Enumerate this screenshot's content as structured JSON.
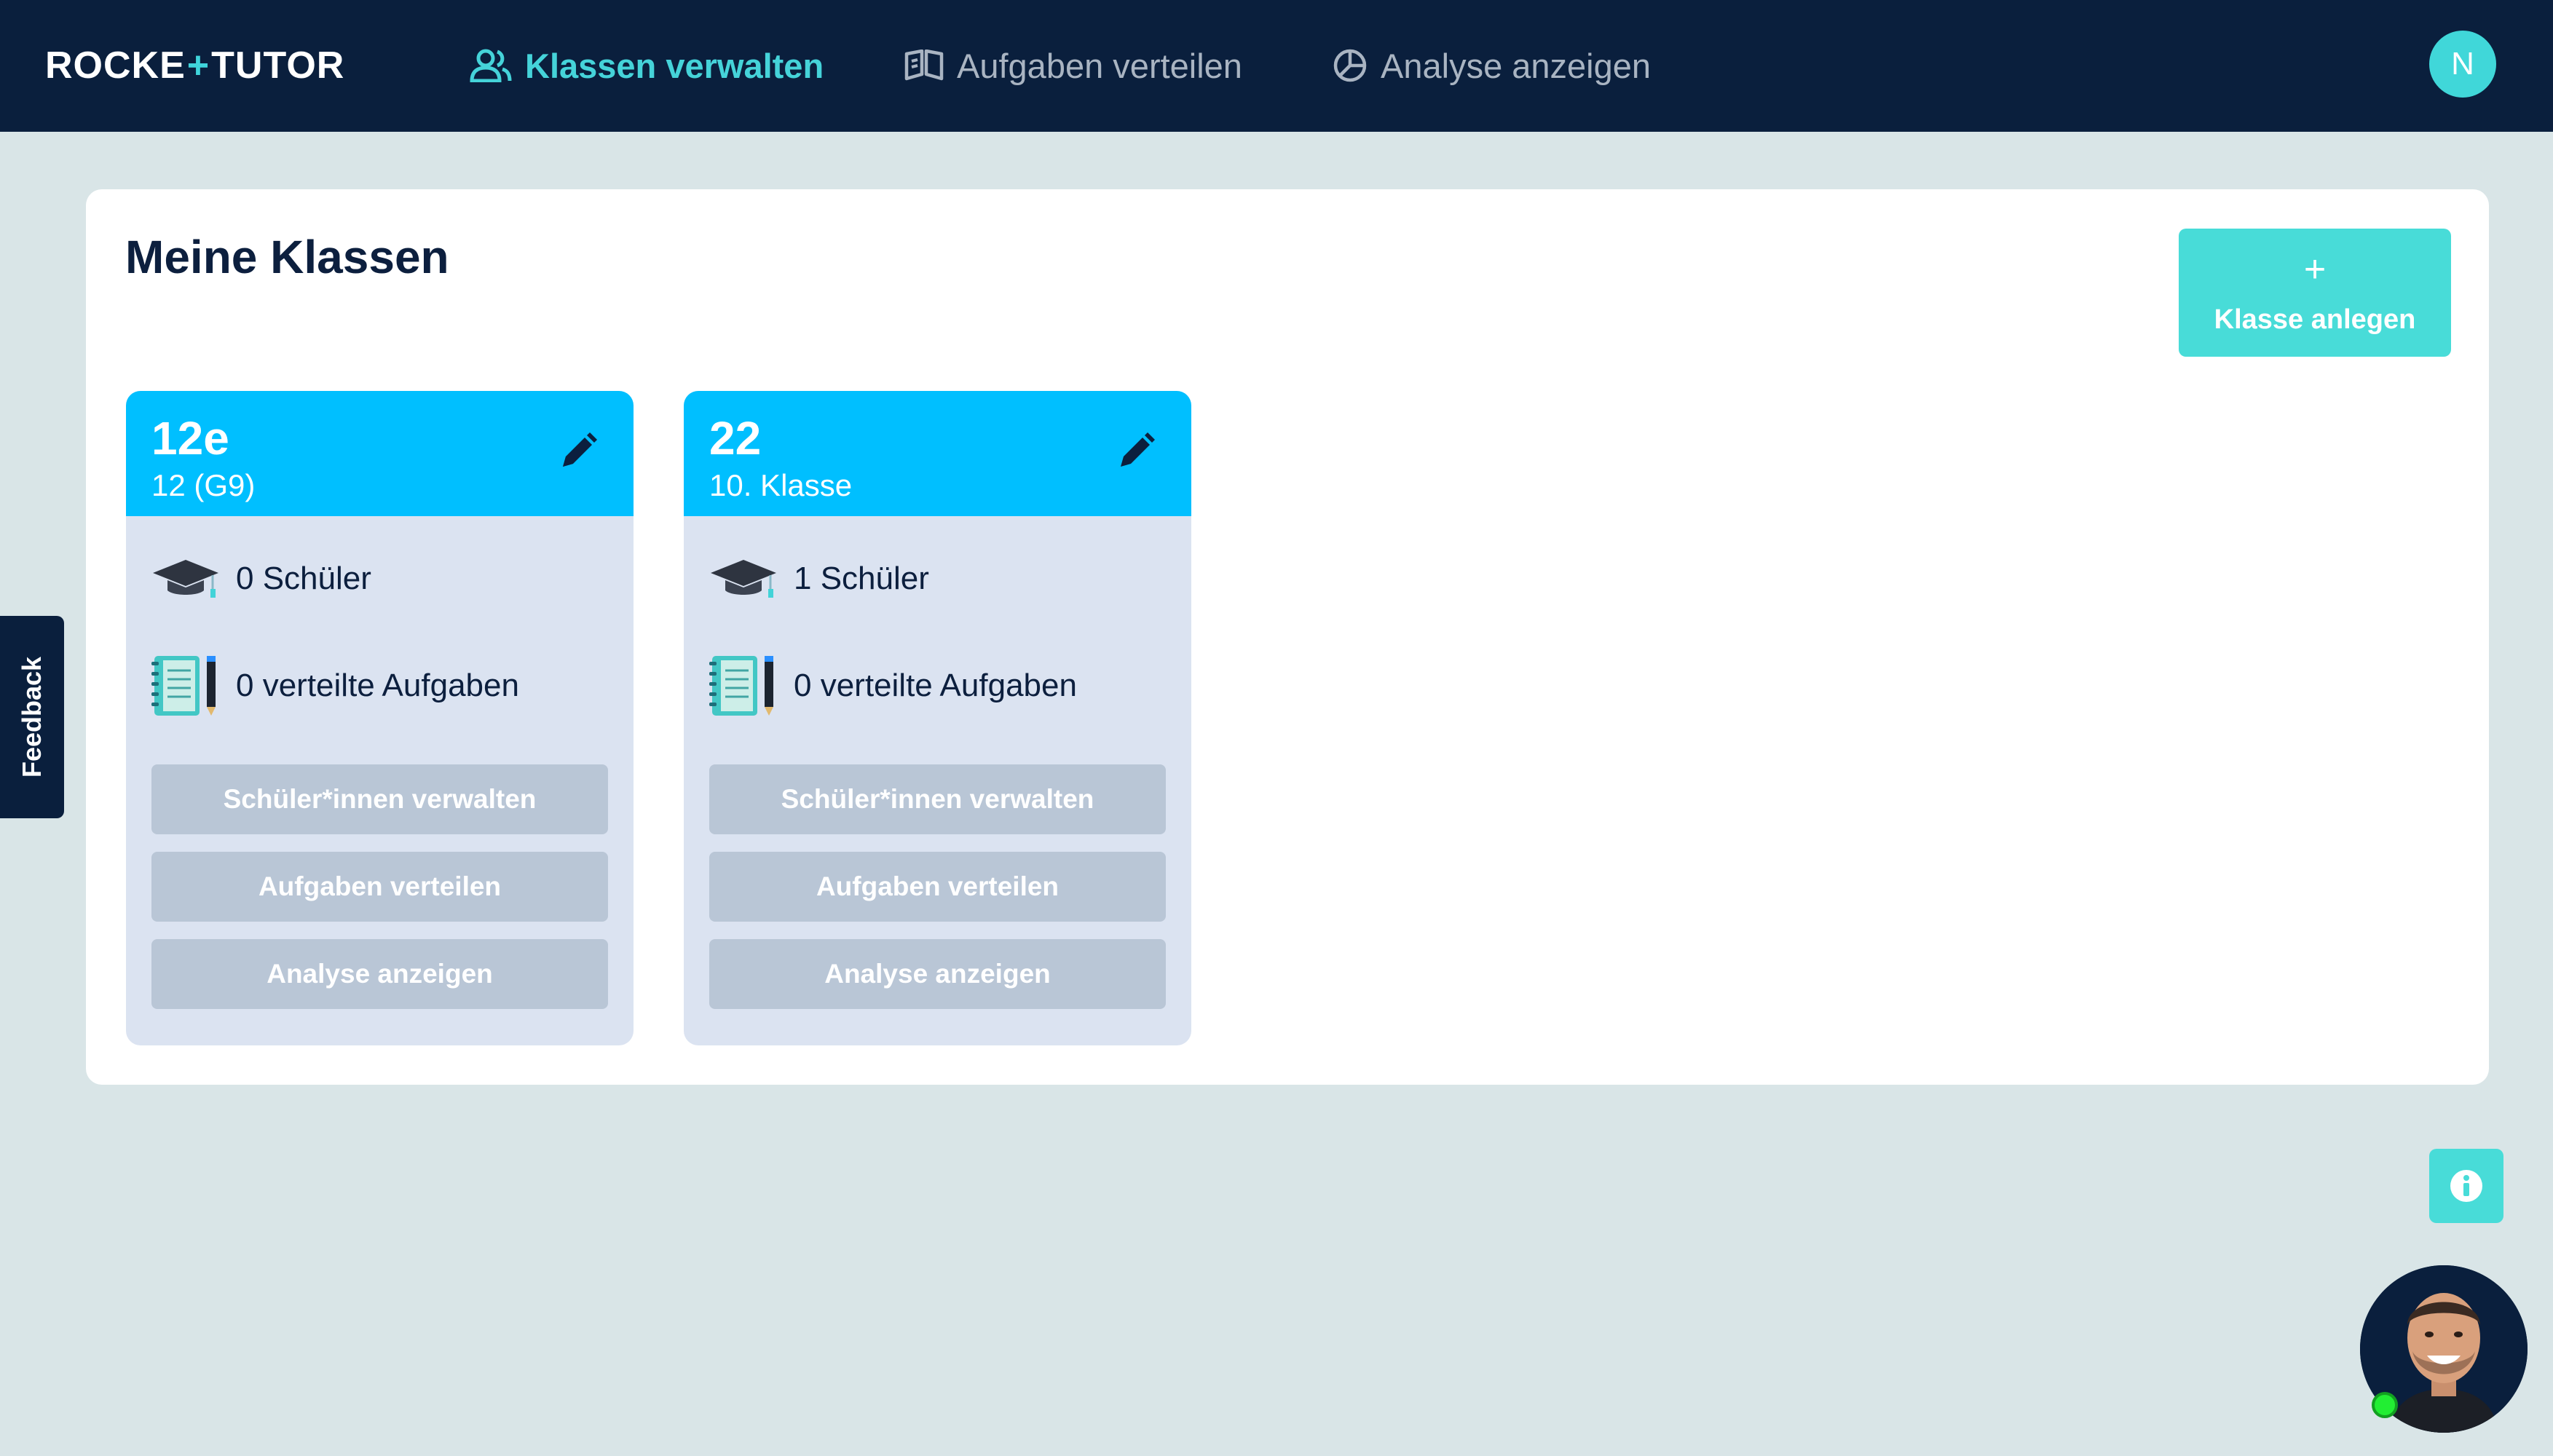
{
  "logo": {
    "part1": "ROCKE",
    "plus": "+",
    "part2": "TUTO",
    "part3": "R"
  },
  "nav": {
    "items": [
      {
        "label": "Klassen verwalten",
        "icon": "users-icon",
        "active": true
      },
      {
        "label": "Aufgaben verteilen",
        "icon": "book-icon",
        "active": false
      },
      {
        "label": "Analyse anzeigen",
        "icon": "pie-chart-icon",
        "active": false
      }
    ]
  },
  "user": {
    "initial": "N"
  },
  "main": {
    "title": "Meine Klassen",
    "add_button": {
      "plus": "+",
      "label": "Klasse anlegen"
    }
  },
  "classes": [
    {
      "name": "12e",
      "subtitle": "12 (G9)",
      "students": "0 Schüler",
      "tasks": "0 verteilte Aufgaben",
      "buttons": [
        "Schüler*innen verwalten",
        "Aufgaben verteilen",
        "Analyse anzeigen"
      ]
    },
    {
      "name": "22",
      "subtitle": "10. Klasse",
      "students": "1 Schüler",
      "tasks": "0 verteilte Aufgaben",
      "buttons": [
        "Schüler*innen verwalten",
        "Aufgaben verteilen",
        "Analyse anzeigen"
      ]
    }
  ],
  "feedback": {
    "label": "Feedback"
  },
  "colors": {
    "topbar": "#0a1f3d",
    "accent": "#45d3d9",
    "card_header": "#00bfff",
    "card_body": "#dbe3f1",
    "disabled_button": "#b9c6d6",
    "online": "#22ee33"
  }
}
